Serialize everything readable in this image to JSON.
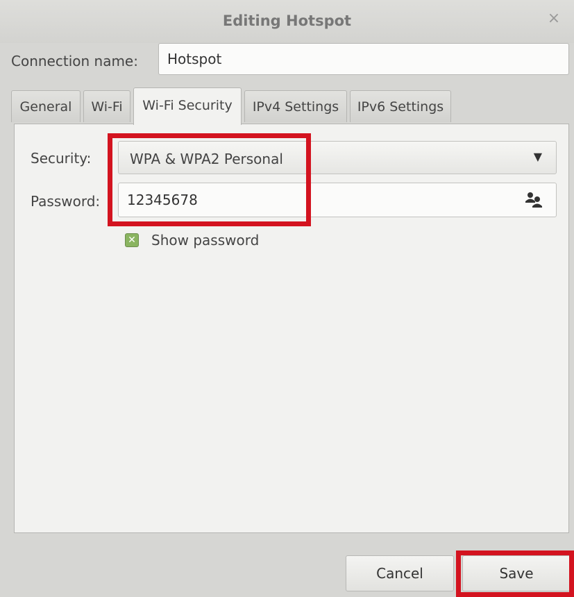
{
  "window": {
    "title": "Editing Hotspot",
    "close_glyph": "×"
  },
  "connection": {
    "label": "Connection name:",
    "value": "Hotspot"
  },
  "tabs": [
    {
      "label": "General",
      "active": false
    },
    {
      "label": "Wi-Fi",
      "active": false
    },
    {
      "label": "Wi-Fi Security",
      "active": true
    },
    {
      "label": "IPv4 Settings",
      "active": false
    },
    {
      "label": "IPv6 Settings",
      "active": false
    }
  ],
  "security": {
    "label": "Security:",
    "selected": "WPA & WPA2 Personal"
  },
  "password": {
    "label": "Password:",
    "value": "12345678",
    "icon": "users-icon"
  },
  "show_password": {
    "label": "Show password",
    "checked": true
  },
  "buttons": {
    "cancel": "Cancel",
    "save": "Save"
  },
  "colors": {
    "highlight": "#d3131f",
    "checkbox_green": "#8ab460"
  }
}
